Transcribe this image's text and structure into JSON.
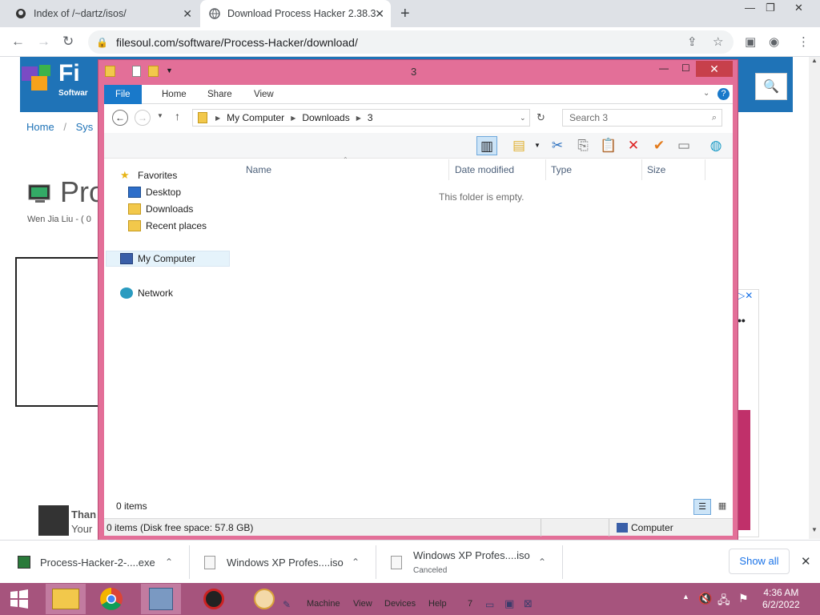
{
  "browser": {
    "tabs": [
      {
        "title": "Index of /~dartz/isos/"
      },
      {
        "title": "Download Process Hacker 2.38.3"
      }
    ],
    "new_tab": "+",
    "url": "filesoul.com/software/Process-Hacker/download/"
  },
  "page": {
    "breadcrumb_home": "Home",
    "breadcrumb_sep": "/",
    "breadcrumb_next": "Sys",
    "title": "Pro",
    "author": "Wen Jia Liu - ( 0",
    "logo_text": "Fi",
    "logo_sub": "Softwar",
    "thanks": "Than",
    "thanks2": "Your"
  },
  "explorer": {
    "title": "3",
    "ribbon_tabs": [
      "File",
      "Home",
      "Share",
      "View"
    ],
    "address": {
      "root": "My Computer",
      "folder1": "Downloads",
      "folder2": "3"
    },
    "search_placeholder": "Search 3",
    "nav": {
      "favorites": "Favorites",
      "desktop": "Desktop",
      "downloads": "Downloads",
      "recent": "Recent places",
      "computer": "My Computer",
      "network": "Network"
    },
    "columns": [
      "Name",
      "Date modified",
      "Type",
      "Size"
    ],
    "empty_message": "This folder is empty.",
    "item_count": "0 items",
    "status_left": "0 items (Disk free space: 57.8 GB)",
    "status_right": "Computer"
  },
  "downloads": [
    {
      "name": "Process-Hacker-2-....exe",
      "status": ""
    },
    {
      "name": "Windows XP Profes....iso",
      "status": ""
    },
    {
      "name": "Windows XP Profes....iso",
      "status": "Canceled"
    }
  ],
  "show_all": "Show all",
  "taskbar": {
    "vbox_menu": [
      "Machine",
      "View",
      "Devices",
      "Help"
    ],
    "vbox_num": "7",
    "time": "4:36 AM",
    "date": "6/2/2022"
  },
  "colors": {
    "explorer_frame": "#e36f98",
    "taskbar": "#a6547d",
    "file_tab": "#1979ca",
    "site_header": "#1f73b7"
  }
}
